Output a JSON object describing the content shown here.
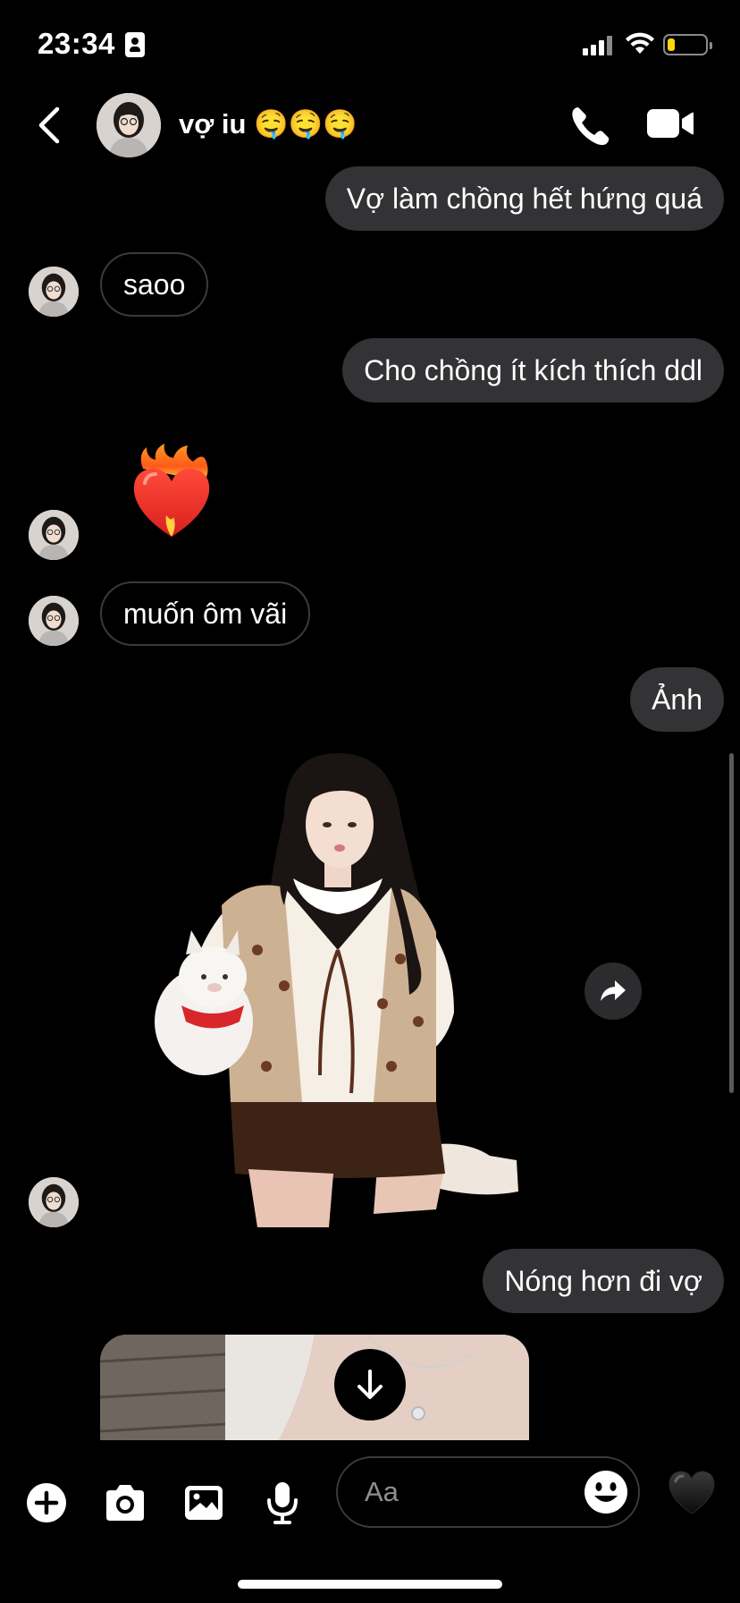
{
  "status_bar": {
    "time": "23:34",
    "battery_level": 0.2,
    "battery_color": "#ffd60a"
  },
  "header": {
    "contact_name": "vợ iu 🤤🤤🤤",
    "icons": [
      "back-icon",
      "phone-icon",
      "video-camera-icon"
    ]
  },
  "messages": [
    {
      "sender": "me",
      "text": "Vợ làm chồng hết hứng quá"
    },
    {
      "sender": "them",
      "text": "saoo"
    },
    {
      "sender": "me",
      "text": "Cho chồng ít kích thích ddl"
    },
    {
      "sender": "them",
      "emoji": "❤️‍🔥"
    },
    {
      "sender": "them",
      "text": "muốn ôm vãi"
    },
    {
      "sender": "me",
      "text": "Ảnh"
    },
    {
      "sender": "them",
      "type": "photo"
    },
    {
      "sender": "me",
      "text": "Nóng hơn đi vợ"
    },
    {
      "sender": "them",
      "type": "photo"
    }
  ],
  "composer": {
    "placeholder": "Aa",
    "icons": [
      "plus-icon",
      "camera-icon",
      "gallery-icon",
      "microphone-icon",
      "emoji-icon",
      "heart-icon"
    ]
  },
  "colors": {
    "background": "#000000",
    "sent_bubble": "#333336",
    "received_border": "#3a3a3c",
    "text": "#ffffff"
  }
}
